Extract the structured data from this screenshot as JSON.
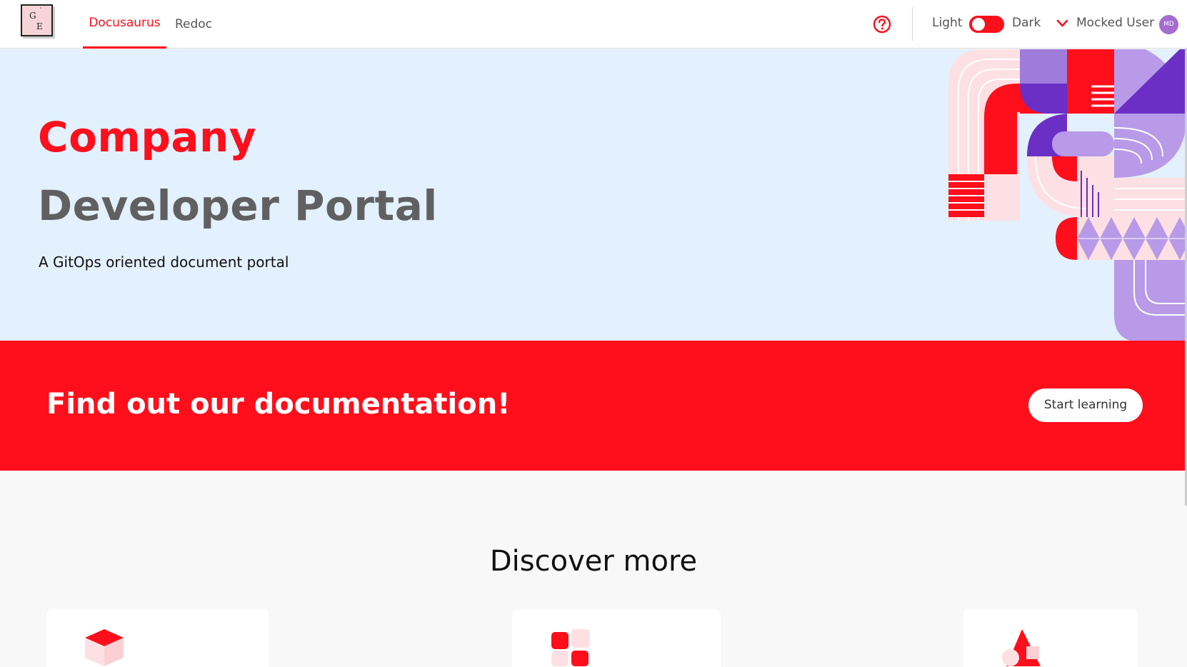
{
  "header": {
    "logo": {
      "letter_top": "G",
      "letter_bottom": "E",
      "mark": "`"
    },
    "tabs": [
      {
        "label": "Docusaurus",
        "active": true
      },
      {
        "label": "Redoc",
        "active": false
      }
    ],
    "help_icon": "question-circle-icon",
    "theme_toggle": {
      "light_label": "Light",
      "dark_label": "Dark",
      "is_dark": false
    },
    "user": {
      "name": "Mocked User",
      "initials": "MD",
      "menu_icon": "chevron-down-icon"
    }
  },
  "hero": {
    "title_line1": "Company",
    "title_line2": "Developer Portal",
    "subtitle": "A GitOps oriented document portal"
  },
  "banner": {
    "text": "Find out our documentation!",
    "button_label": "Start learning"
  },
  "discover": {
    "title": "Discover more",
    "cards": [
      {
        "icon": "cube-icon"
      },
      {
        "icon": "blocks-icon"
      },
      {
        "icon": "shapes-icon"
      }
    ]
  },
  "colors": {
    "brand_red": "#ff0e1c",
    "hero_bg": "#e3f0fd",
    "title_gray": "#606060",
    "purple": "#6b2fc6",
    "lavender": "#b89ae8",
    "pink": "#fde0e3"
  }
}
